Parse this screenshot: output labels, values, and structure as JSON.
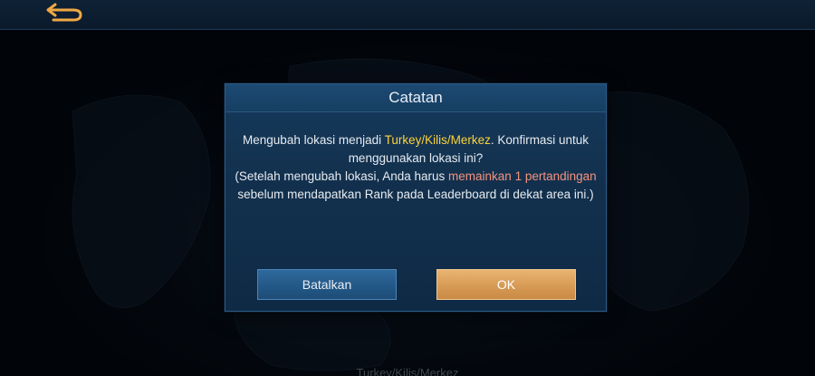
{
  "dialog": {
    "title": "Catatan",
    "message": {
      "line1_prefix": "Mengubah lokasi menjadi ",
      "location": "Turkey/Kilis/Merkez",
      "line1_suffix": ". Konfirmasi untuk menggunakan lokasi ini?",
      "note_prefix": "(Setelah mengubah lokasi, Anda harus ",
      "note_highlight": "memainkan 1 pertandingan",
      "note_suffix": " sebelum mendapatkan Rank pada Leaderboard di dekat area ini.)"
    },
    "cancel_label": "Batalkan",
    "ok_label": "OK"
  },
  "background": {
    "location_label": "Turkey/Kilis/Merkez"
  },
  "icons": {
    "back": "back-arrow-icon"
  },
  "colors": {
    "highlight_location": "#ffd33a",
    "highlight_note": "#f4937e",
    "ok_button": "#d99d58",
    "cancel_button": "#245a89",
    "back_icon": "#f0a844"
  }
}
